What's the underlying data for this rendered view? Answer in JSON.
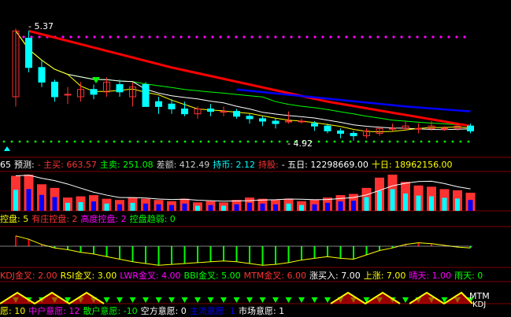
{
  "colors": {
    "bg": "#000000",
    "up": "#ff3232",
    "down": "#00ffff",
    "ma5": "#ffffff",
    "ma10": "#ffff00",
    "ma20": "#ff00ff",
    "ma30": "#00ff00",
    "trend_red": "#ff0000",
    "trend_blue": "#0000ff",
    "dotted_magenta": "#ff00ff",
    "dotted_green": "#00ff00",
    "volume_red": "#ff3232",
    "volume_blue": "#0000ff",
    "macd_green": "#00ff00",
    "macd_red": "#ff0000"
  },
  "chart_data": {
    "type": "candlestick",
    "price_labels": {
      "high": "5.37",
      "low": "4.92"
    },
    "candles": [
      {
        "o": 5.1,
        "c": 5.37,
        "h": 5.38,
        "l": 5.06
      },
      {
        "o": 5.34,
        "c": 5.22,
        "h": 5.37,
        "l": 5.2
      },
      {
        "o": 5.22,
        "c": 5.16,
        "h": 5.25,
        "l": 5.14
      },
      {
        "o": 5.16,
        "c": 5.1,
        "h": 5.17,
        "l": 5.08
      },
      {
        "o": 5.11,
        "c": 5.11,
        "h": 5.14,
        "l": 5.07
      },
      {
        "o": 5.1,
        "c": 5.13,
        "h": 5.16,
        "l": 5.08
      },
      {
        "o": 5.13,
        "c": 5.11,
        "h": 5.15,
        "l": 5.09
      },
      {
        "o": 5.12,
        "c": 5.16,
        "h": 5.18,
        "l": 5.1
      },
      {
        "o": 5.15,
        "c": 5.12,
        "h": 5.17,
        "l": 5.1
      },
      {
        "o": 5.1,
        "c": 5.14,
        "h": 5.16,
        "l": 5.06
      },
      {
        "o": 5.15,
        "c": 5.06,
        "h": 5.16,
        "l": 5.06
      },
      {
        "o": 5.08,
        "c": 5.06,
        "h": 5.1,
        "l": 5.03
      },
      {
        "o": 5.07,
        "c": 5.05,
        "h": 5.09,
        "l": 5.03
      },
      {
        "o": 5.05,
        "c": 5.03,
        "h": 5.08,
        "l": 5.02
      },
      {
        "o": 5.03,
        "c": 5.05,
        "h": 5.06,
        "l": 5.01
      },
      {
        "o": 5.05,
        "c": 5.04,
        "h": 5.07,
        "l": 5.02
      },
      {
        "o": 5.04,
        "c": 5.04,
        "h": 5.06,
        "l": 5.02
      },
      {
        "o": 5.04,
        "c": 5.02,
        "h": 5.05,
        "l": 5.01
      },
      {
        "o": 5.02,
        "c": 5.01,
        "h": 5.03,
        "l": 4.99
      },
      {
        "o": 5.01,
        "c": 5.0,
        "h": 5.02,
        "l": 4.98
      },
      {
        "o": 5.0,
        "c": 4.99,
        "h": 5.01,
        "l": 4.97
      },
      {
        "o": 5.0,
        "c": 5.0,
        "h": 5.04,
        "l": 4.99
      },
      {
        "o": 5.0,
        "c": 5.0,
        "h": 5.01,
        "l": 4.99
      },
      {
        "o": 4.99,
        "c": 4.98,
        "h": 5.0,
        "l": 4.96
      },
      {
        "o": 4.98,
        "c": 4.96,
        "h": 4.99,
        "l": 4.95
      },
      {
        "o": 4.96,
        "c": 4.95,
        "h": 4.97,
        "l": 4.93
      },
      {
        "o": 4.95,
        "c": 4.94,
        "h": 4.96,
        "l": 4.92
      },
      {
        "o": 4.94,
        "c": 4.96,
        "h": 4.97,
        "l": 4.93
      },
      {
        "o": 4.95,
        "c": 4.97,
        "h": 4.98,
        "l": 4.94
      },
      {
        "o": 4.97,
        "c": 4.97,
        "h": 4.99,
        "l": 4.96
      },
      {
        "o": 4.97,
        "c": 4.98,
        "h": 5.0,
        "l": 4.96
      },
      {
        "o": 4.97,
        "c": 4.97,
        "h": 4.99,
        "l": 4.95
      },
      {
        "o": 4.97,
        "c": 4.98,
        "h": 5.0,
        "l": 4.96
      },
      {
        "o": 4.97,
        "c": 4.97,
        "h": 4.98,
        "l": 4.96
      },
      {
        "o": 4.97,
        "c": 4.98,
        "h": 4.99,
        "l": 4.96
      },
      {
        "o": 4.98,
        "c": 4.96,
        "h": 4.99,
        "l": 4.95
      }
    ],
    "volumes": [
      58,
      60,
      44,
      38,
      22,
      24,
      26,
      20,
      18,
      22,
      20,
      18,
      16,
      20,
      14,
      16,
      14,
      18,
      22,
      20,
      18,
      20,
      16,
      18,
      22,
      26,
      28,
      38,
      55,
      60,
      48,
      42,
      40,
      36,
      34,
      30
    ],
    "macd": [
      0.6,
      0.4,
      0.1,
      -0.1,
      -0.2,
      -0.35,
      -0.45,
      -0.6,
      -0.75,
      -0.9,
      -1.0,
      -1.1,
      -1.05,
      -1.0,
      -0.95,
      -0.9,
      -0.85,
      -0.9,
      -1.0,
      -1.1,
      -1.05,
      -0.95,
      -0.8,
      -0.7,
      -0.6,
      -0.7,
      -0.75,
      -0.5,
      -0.25,
      -0.1,
      0.1,
      0.2,
      0.15,
      0.05,
      -0.05,
      -0.1
    ]
  },
  "row1": {
    "items": [
      {
        "text": "65",
        "color": "#ffffff"
      },
      {
        "text": "预测:",
        "color": "#ffffff"
      },
      {
        "text": "- 主买: 663.57",
        "color": "#ff3232"
      },
      {
        "text": "主卖: 251.08",
        "color": "#00ff00"
      },
      {
        "text": "差额: 412.49",
        "color": "#cccccc"
      },
      {
        "text": "持币: 2.12",
        "color": "#00ffff"
      },
      {
        "text": "持股:",
        "color": "#ff3232"
      },
      {
        "text": "- 五日: 12298669.00",
        "color": "#ffffff"
      },
      {
        "text": "十日: 18962156.00",
        "color": "#ffff00"
      }
    ]
  },
  "row2": {
    "items": [
      {
        "text": "控盘: 5",
        "color": "#ffff00"
      },
      {
        "text": "有庄控盘: 2",
        "color": "#ff3232"
      },
      {
        "text": "高度控盘: 2",
        "color": "#ff00ff"
      },
      {
        "text": "控盘趋弱: 0",
        "color": "#00ff00"
      }
    ]
  },
  "row3": {
    "items": [
      {
        "text": "KDJ金叉: 2.00",
        "color": "#ff3232"
      },
      {
        "text": "RSI金叉: 3.00",
        "color": "#ffff00"
      },
      {
        "text": "LWR金叉: 4.00",
        "color": "#ff00ff"
      },
      {
        "text": "BBI金叉: 5.00",
        "color": "#00ff00"
      },
      {
        "text": "MTM金叉: 6.00",
        "color": "#ff3232"
      },
      {
        "text": "涨买入: 7.00",
        "color": "#ffffff"
      },
      {
        "text": "上涨: 7.00",
        "color": "#ffff00"
      },
      {
        "text": "晴天: 1.00",
        "color": "#ff00ff"
      },
      {
        "text": "雨天: 0",
        "color": "#00ff00"
      }
    ]
  },
  "row4": {
    "items": [
      {
        "text": "愿: 10",
        "color": "#ffff00"
      },
      {
        "text": "中户意愿: 12",
        "color": "#ff00ff"
      },
      {
        "text": "散户意愿: -10",
        "color": "#00ff00"
      },
      {
        "text": "空方意愿: 0",
        "color": "#ffffff"
      },
      {
        "text": "主流意愿: 1",
        "color": "#0000ff"
      },
      {
        "text": "市场意愿: 1",
        "color": "#ffffff"
      }
    ]
  },
  "labels": {
    "mtm": "MTM",
    "kdj": "KDJ"
  }
}
